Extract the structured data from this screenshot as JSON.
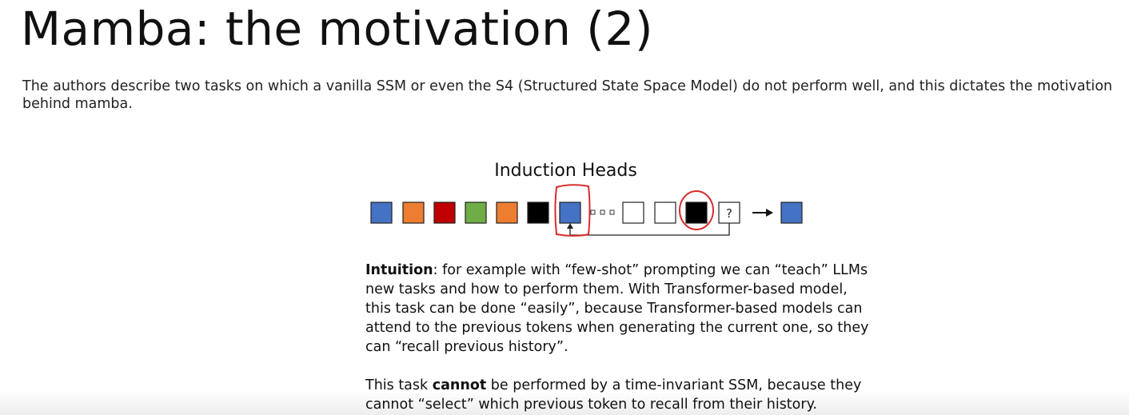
{
  "slide": {
    "title": "Mamba: the motivation (2)",
    "intro": "The authors describe two tasks on which a vanilla SSM or even the S4 (Structured State Space Model) do not perform well, and this dictates the motivation behind mamba."
  },
  "figure": {
    "title": "Induction Heads",
    "query_symbol": "?",
    "token_colors": {
      "blue": "#4472c4",
      "orange": "#ed7d31",
      "red": "#c00000",
      "green": "#70ad47",
      "black": "#000000",
      "empty": "#ffffff",
      "annotation": "#d92b2b"
    },
    "tokens": [
      "blue",
      "orange",
      "red",
      "green",
      "orange",
      "black",
      "blue",
      "ellipsis",
      "empty",
      "empty",
      "black",
      "?"
    ],
    "output_token": "blue"
  },
  "intuition": {
    "label": "Intuition",
    "text": ": for example with “few-shot” prompting we can “teach” LLMs new tasks and how to perform them. With Transformer-based model, this task can be done “easily”, because Transformer-based models can attend to the previous tokens when generating the current one, so they can “recall previous history”."
  },
  "conclusion": {
    "prefix": "This task ",
    "emphasis": "cannot",
    "suffix": " be performed by a time-invariant SSM, because they cannot “select” which previous token to recall from their history."
  }
}
